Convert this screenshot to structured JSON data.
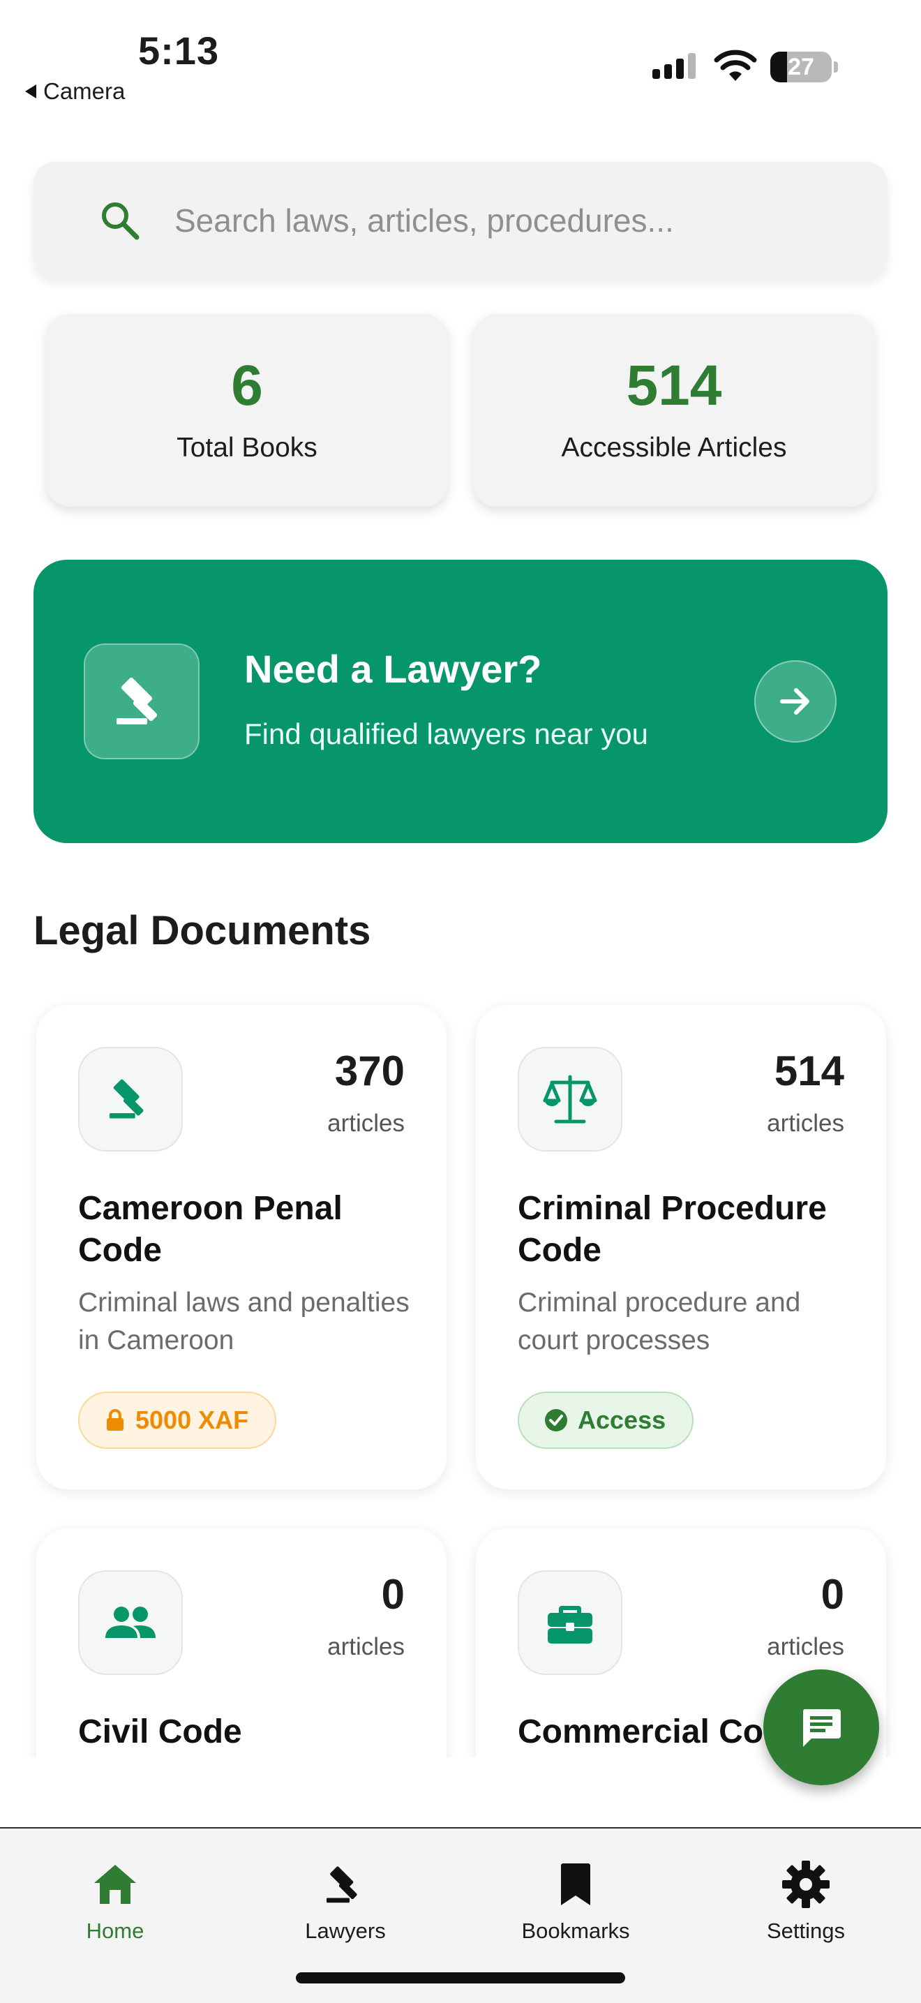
{
  "status_bar": {
    "time": "5:13",
    "back_label": "Camera",
    "battery": "27",
    "battery_level": 0.27
  },
  "search": {
    "placeholder": "Search laws, articles, procedures..."
  },
  "stats": [
    {
      "value": "6",
      "label": "Total Books"
    },
    {
      "value": "514",
      "label": "Accessible Articles"
    }
  ],
  "lawyer_banner": {
    "title": "Need a Lawyer?",
    "subtitle": "Find qualified lawyers near you"
  },
  "section_title": "Legal Documents",
  "documents": [
    {
      "count": "370",
      "count_label": "articles",
      "title": "Cameroon Penal Code",
      "description": "Criminal laws and penalties in Cameroon",
      "badge": "5000 XAF",
      "icon": "gavel-icon"
    },
    {
      "count": "514",
      "count_label": "articles",
      "title": "Criminal Procedure Code",
      "description": "Criminal procedure and court processes",
      "badge": "Access",
      "icon": "scales-icon"
    },
    {
      "count": "0",
      "count_label": "articles",
      "title": "Civil Code",
      "icon": "people-icon"
    },
    {
      "count": "0",
      "count_label": "articles",
      "title": "Commercial Code",
      "icon": "briefcase-icon"
    }
  ],
  "tabs": [
    {
      "label": "Home",
      "icon": "home-icon"
    },
    {
      "label": "Lawyers",
      "icon": "gavel-icon"
    },
    {
      "label": "Bookmarks",
      "icon": "bookmark-icon"
    },
    {
      "label": "Settings",
      "icon": "gear-icon"
    }
  ],
  "colors": {
    "primary_green": "#2e7d32",
    "banner_green": "#079669",
    "price_orange": "#ef8a05"
  }
}
